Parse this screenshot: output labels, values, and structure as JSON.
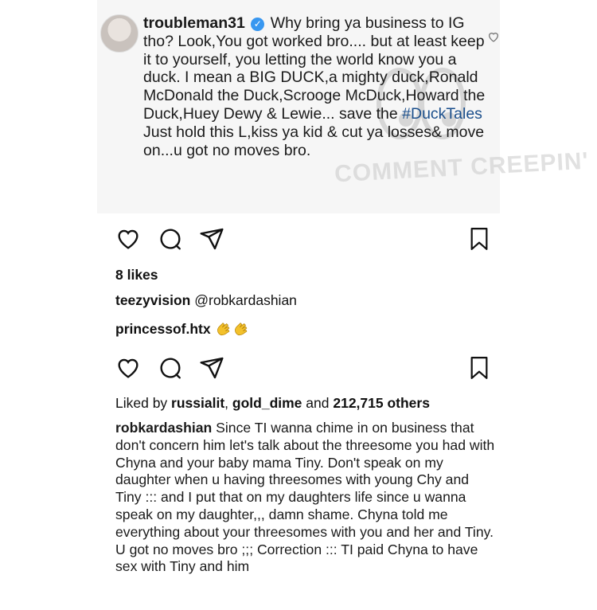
{
  "top_comment": {
    "username": "troubleman31",
    "text_before_hashtag": "Why bring ya business to IG tho? Look,You got worked bro.... but at least keep it to yourself, you letting the world know you a duck. I mean a BIG DUCK,a mighty duck,Ronald McDonald the Duck,Scrooge McDuck,Howard the Duck,Huey Dewy & Lewie... save the ",
    "hashtag": "#DuckTales",
    "text_after_hashtag": " Just hold this L,kiss ya kid & cut ya losses& move on...u got no moves bro.",
    "watermark": "COMMENT CREEPIN'"
  },
  "post1": {
    "likes": "8 likes",
    "comment1_user": "teezyvision",
    "comment1_text": "@robkardashian",
    "comment2_user": "princessof.htx"
  },
  "post2": {
    "liked_prefix": "Liked by ",
    "liked_user1": "russialit",
    "liked_sep": ", ",
    "liked_user2": "gold_dime",
    "liked_and": " and ",
    "liked_count": "212,715 others",
    "caption_user": "robkardashian",
    "caption_text": "Since TI wanna chime in on business that don't concern him let's talk about the threesome you had with Chyna and your baby mama Tiny. Don't speak on my daughter when u having threesomes with young Chy and Tiny ::: and I put that on my daughters life since u wanna speak on my daughter,,, damn shame. Chyna told me everything about your threesomes with you and her and Tiny.  U got no moves bro ;;; Correction ::: TI paid Chyna to have sex with Tiny and him"
  },
  "icons": [
    "heart-icon",
    "comment-icon",
    "share-icon",
    "bookmark-icon",
    "clap-emoji",
    "verified-badge-icon"
  ],
  "colors": {
    "hashtag": "#1b4f8c",
    "verified": "#3897f0"
  }
}
